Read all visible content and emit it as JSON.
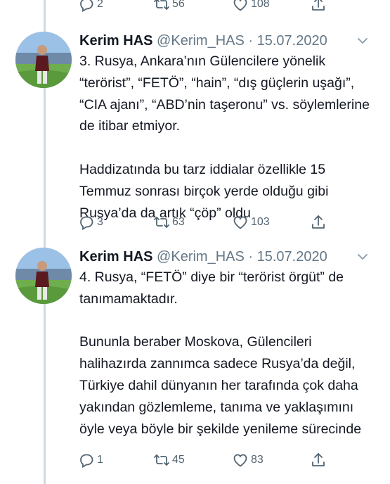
{
  "top_actions": {
    "reply_count": "2",
    "retweet_count": "56",
    "like_count": "108"
  },
  "tweets": [
    {
      "author_name": "Kerim HAS",
      "author_handle": "@Kerim_HAS",
      "separator": "·",
      "date": "15.07.2020",
      "paragraphs": [
        "3. Rusya, Ankara’nın Gülencilere yönelik “terörist”, “FETÖ”, “hain”, “dış güçlerin uşağı”, “CIA ajanı”, “ABD’nin taşeronu” vs. söylemlerine de itibar etmiyor.",
        "Haddizatında bu tarz iddialar özellikle 15 Temmuz sonrası birçok yerde olduğu gibi Rusya’da da artık “çöp” oldu"
      ],
      "reply_count": "3",
      "retweet_count": "63",
      "like_count": "103"
    },
    {
      "author_name": "Kerim HAS",
      "author_handle": "@Kerim_HAS",
      "separator": "·",
      "date": "15.07.2020",
      "paragraphs": [
        "4. Rusya, “FETÖ” diye bir “terörist örgüt” de tanımamaktadır.",
        "Bununla beraber Moskova, Gülencileri halihazırda zannımca sadece Rusya’da değil, Türkiye dahil dünyanın her tarafında çok daha yakından gözlemleme, tanıma ve yaklaşımını öyle veya böyle bir şekilde yenileme sürecinde"
      ],
      "reply_count": "1",
      "retweet_count": "45",
      "like_count": "83"
    }
  ],
  "colors": {
    "text": "#141823",
    "muted": "#536471",
    "thread_line": "#cfd9de"
  }
}
